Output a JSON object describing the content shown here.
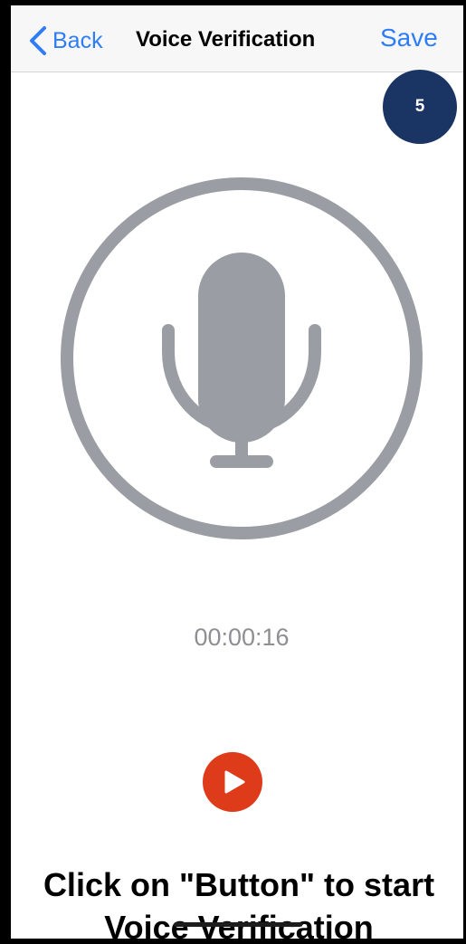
{
  "navbar": {
    "back_label": "Back",
    "title": "Voice Verification",
    "save_label": "Save"
  },
  "badge": {
    "step_number": "5"
  },
  "recorder": {
    "mic_icon": "microphone-icon",
    "elapsed_time": "00:00:16",
    "play_icon": "play-icon"
  },
  "instruction": {
    "line1": "Click on \"Button\" to start",
    "line2": "Voice Verification"
  },
  "colors": {
    "accent": "#2f7df6",
    "badge": "#1a3463",
    "play_button": "#dd3b1a",
    "icon_gray": "#9a9da3"
  }
}
